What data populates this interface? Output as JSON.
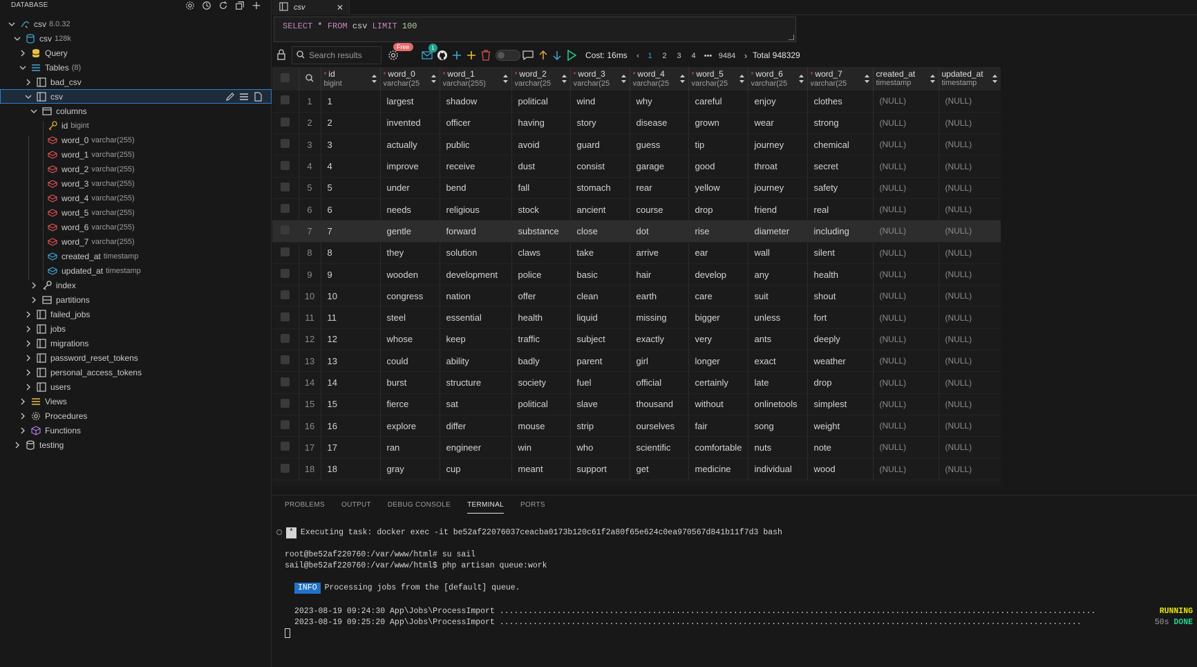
{
  "sidebar": {
    "title": "DATABASE",
    "tree": [
      {
        "label": "csv",
        "sub": "8.0.32"
      },
      {
        "label": "csv",
        "sub": "128k"
      },
      {
        "label": "Query",
        "sub": ""
      },
      {
        "label": "Tables",
        "sub": "(8)"
      },
      {
        "label": "bad_csv",
        "sub": ""
      },
      {
        "label": "csv",
        "sub": ""
      },
      {
        "label": "columns",
        "sub": ""
      },
      {
        "label": "id",
        "sub": "bigint"
      },
      {
        "label": "word_0",
        "sub": "varchar(255)"
      },
      {
        "label": "word_1",
        "sub": "varchar(255)"
      },
      {
        "label": "word_2",
        "sub": "varchar(255)"
      },
      {
        "label": "word_3",
        "sub": "varchar(255)"
      },
      {
        "label": "word_4",
        "sub": "varchar(255)"
      },
      {
        "label": "word_5",
        "sub": "varchar(255)"
      },
      {
        "label": "word_6",
        "sub": "varchar(255)"
      },
      {
        "label": "word_7",
        "sub": "varchar(255)"
      },
      {
        "label": "created_at",
        "sub": "timestamp"
      },
      {
        "label": "updated_at",
        "sub": "timestamp"
      },
      {
        "label": "index",
        "sub": ""
      },
      {
        "label": "partitions",
        "sub": ""
      },
      {
        "label": "failed_jobs",
        "sub": ""
      },
      {
        "label": "jobs",
        "sub": ""
      },
      {
        "label": "migrations",
        "sub": ""
      },
      {
        "label": "password_reset_tokens",
        "sub": ""
      },
      {
        "label": "personal_access_tokens",
        "sub": ""
      },
      {
        "label": "users",
        "sub": ""
      },
      {
        "label": "Views",
        "sub": ""
      },
      {
        "label": "Procedures",
        "sub": ""
      },
      {
        "label": "Functions",
        "sub": ""
      },
      {
        "label": "testing",
        "sub": ""
      }
    ]
  },
  "tab": {
    "label": "csv"
  },
  "query": {
    "select": "SELECT",
    "star": "*",
    "from": "FROM",
    "table": "csv",
    "limit": "LIMIT",
    "n": "100"
  },
  "toolbar": {
    "search_placeholder": "Search results",
    "free_badge": "Free",
    "count_badge": "1",
    "cost": "Cost: 16ms",
    "pages": [
      "1",
      "2",
      "3",
      "4",
      "•••",
      "9484"
    ],
    "total": "Total 948329"
  },
  "grid": {
    "columns": [
      {
        "name": "id",
        "type": "bigint",
        "required": true
      },
      {
        "name": "word_0",
        "type": "varchar(25",
        "required": true
      },
      {
        "name": "word_1",
        "type": "varchar(255)",
        "required": true
      },
      {
        "name": "word_2",
        "type": "varchar(25",
        "required": true
      },
      {
        "name": "word_3",
        "type": "varchar(25",
        "required": true
      },
      {
        "name": "word_4",
        "type": "varchar(25",
        "required": true
      },
      {
        "name": "word_5",
        "type": "varchar(25",
        "required": true
      },
      {
        "name": "word_6",
        "type": "varchar(25",
        "required": true
      },
      {
        "name": "word_7",
        "type": "varchar(25",
        "required": true
      },
      {
        "name": "created_at",
        "type": "timestamp",
        "required": false
      },
      {
        "name": "updated_at",
        "type": "timestamp",
        "required": false
      }
    ],
    "highlighted_row": 7,
    "rows": [
      [
        "1",
        "1",
        "largest",
        "shadow",
        "political",
        "wind",
        "why",
        "careful",
        "enjoy",
        "clothes",
        "(NULL)",
        "(NULL)"
      ],
      [
        "2",
        "2",
        "invented",
        "officer",
        "having",
        "story",
        "disease",
        "grown",
        "wear",
        "strong",
        "(NULL)",
        "(NULL)"
      ],
      [
        "3",
        "3",
        "actually",
        "public",
        "avoid",
        "guard",
        "guess",
        "tip",
        "journey",
        "chemical",
        "(NULL)",
        "(NULL)"
      ],
      [
        "4",
        "4",
        "improve",
        "receive",
        "dust",
        "consist",
        "garage",
        "good",
        "throat",
        "secret",
        "(NULL)",
        "(NULL)"
      ],
      [
        "5",
        "5",
        "under",
        "bend",
        "fall",
        "stomach",
        "rear",
        "yellow",
        "journey",
        "safety",
        "(NULL)",
        "(NULL)"
      ],
      [
        "6",
        "6",
        "needs",
        "religious",
        "stock",
        "ancient",
        "course",
        "drop",
        "friend",
        "real",
        "(NULL)",
        "(NULL)"
      ],
      [
        "7",
        "7",
        "gentle",
        "forward",
        "substance",
        "close",
        "dot",
        "rise",
        "diameter",
        "including",
        "(NULL)",
        "(NULL)"
      ],
      [
        "8",
        "8",
        "they",
        "solution",
        "claws",
        "take",
        "arrive",
        "ear",
        "wall",
        "silent",
        "(NULL)",
        "(NULL)"
      ],
      [
        "9",
        "9",
        "wooden",
        "development",
        "police",
        "basic",
        "hair",
        "develop",
        "any",
        "health",
        "(NULL)",
        "(NULL)"
      ],
      [
        "10",
        "10",
        "congress",
        "nation",
        "offer",
        "clean",
        "earth",
        "care",
        "suit",
        "shout",
        "(NULL)",
        "(NULL)"
      ],
      [
        "11",
        "11",
        "steel",
        "essential",
        "health",
        "liquid",
        "missing",
        "bigger",
        "unless",
        "fort",
        "(NULL)",
        "(NULL)"
      ],
      [
        "12",
        "12",
        "whose",
        "keep",
        "traffic",
        "subject",
        "exactly",
        "very",
        "ants",
        "deeply",
        "(NULL)",
        "(NULL)"
      ],
      [
        "13",
        "13",
        "could",
        "ability",
        "badly",
        "parent",
        "girl",
        "longer",
        "exact",
        "weather",
        "(NULL)",
        "(NULL)"
      ],
      [
        "14",
        "14",
        "burst",
        "structure",
        "society",
        "fuel",
        "official",
        "certainly",
        "late",
        "drop",
        "(NULL)",
        "(NULL)"
      ],
      [
        "15",
        "15",
        "fierce",
        "sat",
        "political",
        "slave",
        "thousand",
        "without",
        "onlinetools",
        "simplest",
        "(NULL)",
        "(NULL)"
      ],
      [
        "16",
        "16",
        "explore",
        "differ",
        "mouse",
        "strip",
        "ourselves",
        "fair",
        "song",
        "weight",
        "(NULL)",
        "(NULL)"
      ],
      [
        "17",
        "17",
        "ran",
        "engineer",
        "win",
        "who",
        "scientific",
        "comfortable",
        "nuts",
        "note",
        "(NULL)",
        "(NULL)"
      ],
      [
        "18",
        "18",
        "gray",
        "cup",
        "meant",
        "support",
        "get",
        "medicine",
        "individual",
        "wood",
        "(NULL)",
        "(NULL)"
      ]
    ]
  },
  "panel": {
    "tabs": [
      "PROBLEMS",
      "OUTPUT",
      "DEBUG CONSOLE",
      "TERMINAL",
      "PORTS"
    ],
    "active_tab": "TERMINAL",
    "terminal": {
      "task_star": "*",
      "task": "Executing task: docker exec -it be52af22076037ceacba0173b120c61f2a80f65e624c0ea970567d841b11f7d3 bash",
      "line1": "root@be52af220760:/var/www/html# su sail",
      "line2": "sail@be52af220760:/var/www/html$ php artisan queue:work",
      "info_badge": "INFO",
      "info_text": "Processing jobs from the [default] queue.",
      "job1": "2023-08-19 09:24:30 App\\Jobs\\ProcessImport .............................................................................................................................",
      "job1_status": "RUNNING",
      "job2": "2023-08-19 09:25:20 App\\Jobs\\ProcessImport ..........................................................................................................................",
      "job2_time": "50s",
      "job2_status": "DONE"
    }
  },
  "colors": {
    "accent": "#2f7fc6",
    "required": "#e05252",
    "running": "#e5e510",
    "done": "#23d18b"
  }
}
